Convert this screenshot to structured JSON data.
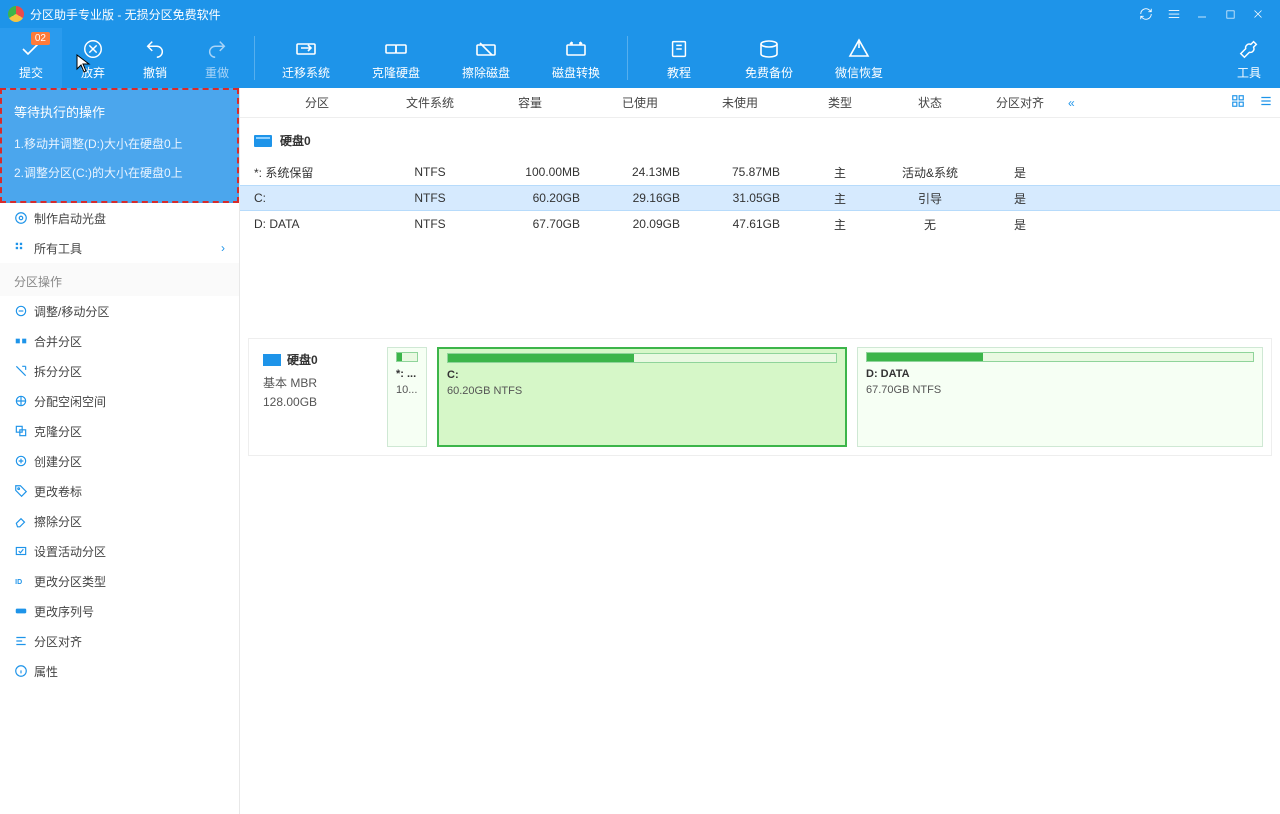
{
  "title": "分区助手专业版 - 无损分区免费软件",
  "badge_count": "02",
  "toolbar": {
    "commit": "提交",
    "discard": "放弃",
    "undo": "撤销",
    "redo": "重做",
    "migrate": "迁移系统",
    "clone": "克隆硬盘",
    "wipe": "擦除磁盘",
    "convert": "磁盘转换",
    "tutorial": "教程",
    "backup": "免费备份",
    "wechat": "微信恢复",
    "tools": "工具"
  },
  "pending": {
    "title": "等待执行的操作",
    "items": [
      "1.移动并调整(D:)大小在硬盘0上",
      "2.调整分区(C:)的大小在硬盘0上"
    ]
  },
  "side_quick": {
    "make_boot": "制作启动光盘",
    "all_tools": "所有工具"
  },
  "side_hdr": "分区操作",
  "side_ops": [
    "调整/移动分区",
    "合并分区",
    "拆分分区",
    "分配空闲空间",
    "克隆分区",
    "创建分区",
    "更改卷标",
    "擦除分区",
    "设置活动分区",
    "更改分区类型",
    "更改序列号",
    "分区对齐",
    "属性"
  ],
  "cols": {
    "part": "分区",
    "fs": "文件系统",
    "cap": "容量",
    "used": "已使用",
    "free": "未使用",
    "type": "类型",
    "state": "状态",
    "align": "分区对齐"
  },
  "disk_label": "硬盘0",
  "rows": [
    {
      "part": "*: 系统保留",
      "fs": "NTFS",
      "cap": "100.00MB",
      "used": "24.13MB",
      "free": "75.87MB",
      "type": "主",
      "state": "活动&系统",
      "align": "是"
    },
    {
      "part": "C:",
      "fs": "NTFS",
      "cap": "60.20GB",
      "used": "29.16GB",
      "free": "31.05GB",
      "type": "主",
      "state": "引导",
      "align": "是",
      "selected": true
    },
    {
      "part": "D: DATA",
      "fs": "NTFS",
      "cap": "67.70GB",
      "used": "20.09GB",
      "free": "47.61GB",
      "type": "主",
      "state": "无",
      "align": "是"
    }
  ],
  "diskmap": {
    "disk_name": "硬盘0",
    "disk_type": "基本 MBR",
    "disk_size": "128.00GB",
    "reserved_label": "*: ...",
    "reserved_sub": "10...",
    "c_label": "C:",
    "c_sub": "60.20GB NTFS",
    "d_label": "D: DATA",
    "d_sub": "67.70GB NTFS"
  }
}
